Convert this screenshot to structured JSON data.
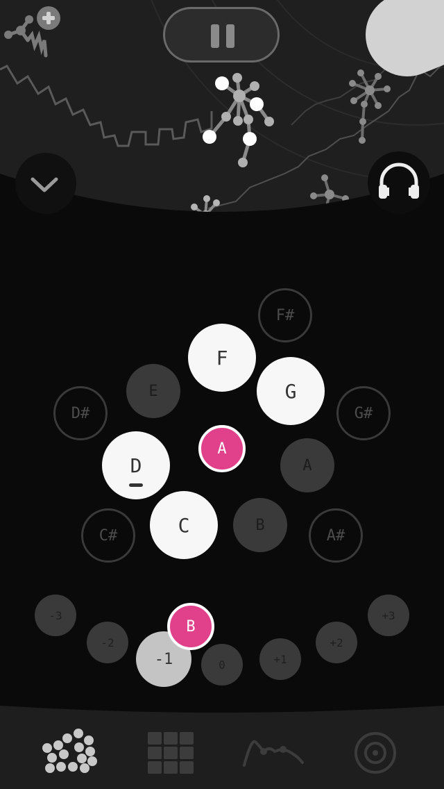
{
  "controls": {
    "pause": "pause-icon",
    "add_instrument": "add-instrument-icon",
    "collapse": "chevron-down-icon",
    "audio": "headphones-icon"
  },
  "notes": [
    {
      "name": "F#",
      "state": "inactive"
    },
    {
      "name": "F",
      "state": "active"
    },
    {
      "name": "E",
      "state": "dim"
    },
    {
      "name": "G",
      "state": "active"
    },
    {
      "name": "D#",
      "state": "inactive"
    },
    {
      "name": "G#",
      "state": "inactive"
    },
    {
      "name": "D",
      "state": "active",
      "root": true
    },
    {
      "name": "A",
      "state": "dim"
    },
    {
      "name": "C#",
      "state": "inactive"
    },
    {
      "name": "C",
      "state": "active"
    },
    {
      "name": "B",
      "state": "dim"
    },
    {
      "name": "A#",
      "state": "inactive"
    }
  ],
  "note_marker": "A",
  "octaves": [
    "-3",
    "-2",
    "-1",
    "0",
    "+1",
    "+2",
    "+3"
  ],
  "selected_octave": "-1",
  "octave_marker": "B",
  "nav": [
    {
      "id": "dots",
      "icon": "dots-pattern-icon"
    },
    {
      "id": "grid",
      "icon": "grid-icon"
    },
    {
      "id": "curve",
      "icon": "curve-icon"
    },
    {
      "id": "target",
      "icon": "target-icon"
    }
  ],
  "colors": {
    "accent": "#e0418a",
    "active_note": "#f7f7f7",
    "dim_note": "#3a3a3a"
  }
}
